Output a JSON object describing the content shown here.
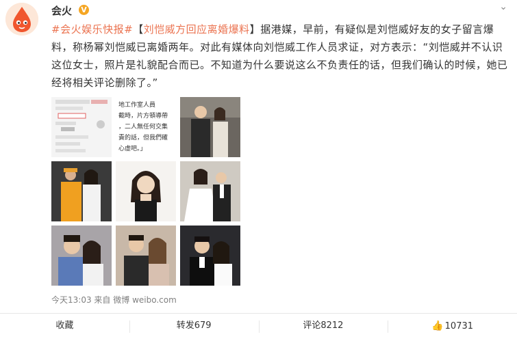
{
  "user": {
    "name": "会火",
    "verified_badge": "V",
    "avatar_color": "#f0562e"
  },
  "post": {
    "topic": "#会火娱乐快报#",
    "title_open": "【",
    "title": "刘恺威方回应离婚爆料",
    "title_close": "】",
    "body": "据港媒，早前，有疑似是刘恺威好友的女子留言爆料，称杨幂刘恺威已离婚两年。对此有媒体向刘恺威工作人员求证，对方表示：“刘恺威并不认识这位女士，照片是礼貌配合而已。不知道为什么要说这么不负责任的话，但我们确认的时候，她已经将相关评论删除了。”"
  },
  "images": {
    "screenshot2_text": "地工作室人員\n截時，片方頓導帶\n，二人無任何交集\n責的話，但我們確\n心虛吧。」"
  },
  "meta": {
    "time": "今天13:03",
    "from": "来自",
    "source": "微博 weibo.com"
  },
  "actions": {
    "favorite": "收藏",
    "repost": "转发679",
    "comment": "评论8212",
    "like": "10731"
  },
  "colors": {
    "accent": "#eb7350",
    "link": "#eb7350",
    "meta": "#808080"
  }
}
